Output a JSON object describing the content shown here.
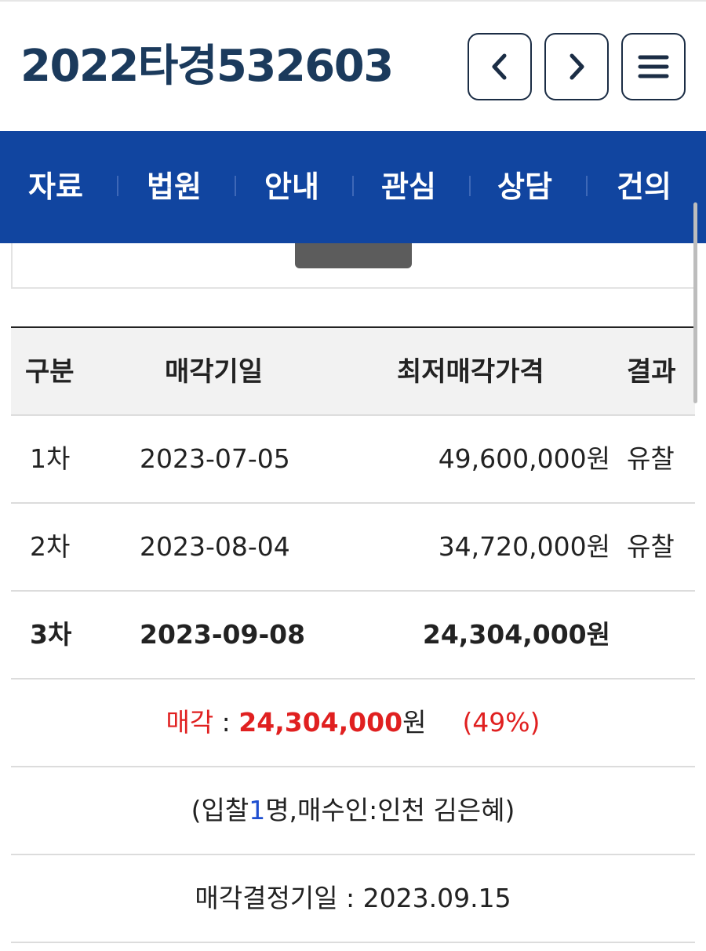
{
  "header": {
    "case_number": "2022타경532603",
    "prev_icon": "chevron-left-icon",
    "next_icon": "chevron-right-icon",
    "menu_icon": "hamburger-menu-icon"
  },
  "nav": {
    "items": [
      "자료",
      "법원",
      "안내",
      "관심",
      "상담",
      "건의"
    ],
    "bg_color": "#1145a0"
  },
  "table": {
    "headers": {
      "gubun": "구분",
      "date": "매각기일",
      "price": "최저매각가격",
      "result": "결과"
    },
    "rows": [
      {
        "gubun": "1차",
        "date": "2023-07-05",
        "price": "49,600,000원",
        "result": "유찰"
      },
      {
        "gubun": "2차",
        "date": "2023-08-04",
        "price": "34,720,000원",
        "result": "유찰"
      },
      {
        "gubun": "3차",
        "date": "2023-09-08",
        "price": "24,304,000원",
        "result": ""
      }
    ]
  },
  "sale": {
    "label": "매각",
    "colon": " : ",
    "amount": "24,304,000",
    "unit": "원",
    "percent": "(49%)"
  },
  "bidders": {
    "prefix": "(입찰",
    "count": "1",
    "suffix": "명,매수인:인천 김은혜)"
  },
  "decision": {
    "text": "매각결정기일 : 2023.09.15"
  },
  "colors": {
    "accent_red": "#e02020",
    "accent_blue": "#1e4fd0",
    "title_navy": "#1b3a5c"
  }
}
